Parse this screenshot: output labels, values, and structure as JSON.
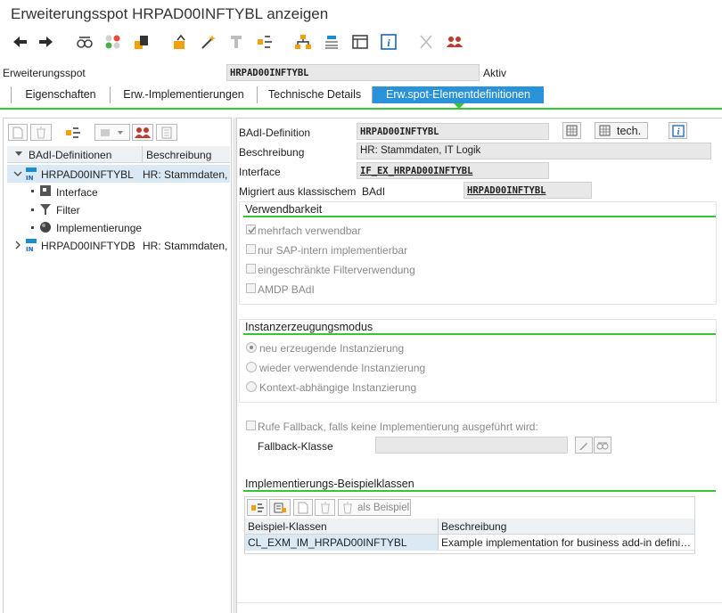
{
  "window": {
    "title": "Erweiterungsspot HRPAD00INFTYBL anzeigen"
  },
  "toolbar": {
    "icons": [
      "back-icon",
      "forward-icon",
      "other-object-icon",
      "display-change-icon",
      "activate-icon",
      "check-icon",
      "wand-icon",
      "where-used-icon",
      "hierarchy-icon",
      "object-list-icon",
      "layout-icon",
      "info-icon",
      "cut-icon",
      "users-icon"
    ]
  },
  "header": {
    "spot_label": "Erweiterungsspot",
    "spot_value": "HRPAD00INFTYBL",
    "status": "Aktiv"
  },
  "tabs": [
    {
      "label": "Eigenschaften"
    },
    {
      "label": "Erw.-Implementierungen"
    },
    {
      "label": "Technische Details"
    },
    {
      "label": "Erw.spot-Elementdefinitionen"
    }
  ],
  "tree": {
    "col_def": "BAdI-Definitionen",
    "col_desc": "Beschreibung",
    "items": [
      {
        "name": "HRPAD00INFTYBL",
        "desc": "HR: Stammdaten,"
      },
      {
        "name": "Interface"
      },
      {
        "name": "Filter"
      },
      {
        "name": "Implementierunge"
      },
      {
        "name": "HRPAD00INFTYDB",
        "desc": "HR: Stammdaten,"
      }
    ]
  },
  "detail": {
    "badi_def_label": "BAdI-Definition",
    "badi_def_value": "HRPAD00INFTYBL",
    "tech_label": "tech.",
    "desc_label": "Beschreibung",
    "desc_value": "HR: Stammdaten, IT Logik",
    "interface_label": "Interface",
    "interface_value": "IF_EX_HRPAD00INFTYBL",
    "migrated_label": "Migriert aus klassischem  BAdI",
    "migrated_value": "HRPAD00INFTYBL"
  },
  "usability": {
    "title": "Verwendbarkeit",
    "options": [
      {
        "label": "mehrfach verwendbar",
        "checked": true
      },
      {
        "label": "nur SAP-intern implementierbar",
        "checked": false
      },
      {
        "label": "eingeschränkte Filterverwendung",
        "checked": false
      },
      {
        "label": "AMDP BAdI",
        "checked": false
      }
    ]
  },
  "instantiation": {
    "title": "Instanzerzeugungsmodus",
    "options": [
      {
        "label": "neu erzeugende Instanzierung",
        "selected": true
      },
      {
        "label": "wieder verwendende Instanzierung",
        "selected": false
      },
      {
        "label": "Kontext-abhängige Instanzierung",
        "selected": false
      }
    ]
  },
  "fallback": {
    "checkbox_label": "Rufe Fallback, falls keine Implementierung ausgeführt wird:",
    "class_label": "Fallback-Klasse",
    "class_value": ""
  },
  "examples": {
    "title": "Implementierungs-Beispielklassen",
    "as_example_label": "als Beispiel",
    "col_class": "Beispiel-Klassen",
    "col_desc": "Beschreibung",
    "rows": [
      {
        "cls": "CL_EXM_IM_HRPAD00INFTYBL",
        "desc": "Example implementation for business add-in defini…"
      }
    ]
  },
  "colors": {
    "accent": "#2a92d6",
    "green": "#35c635",
    "selected_row": "#dbe9f5"
  }
}
